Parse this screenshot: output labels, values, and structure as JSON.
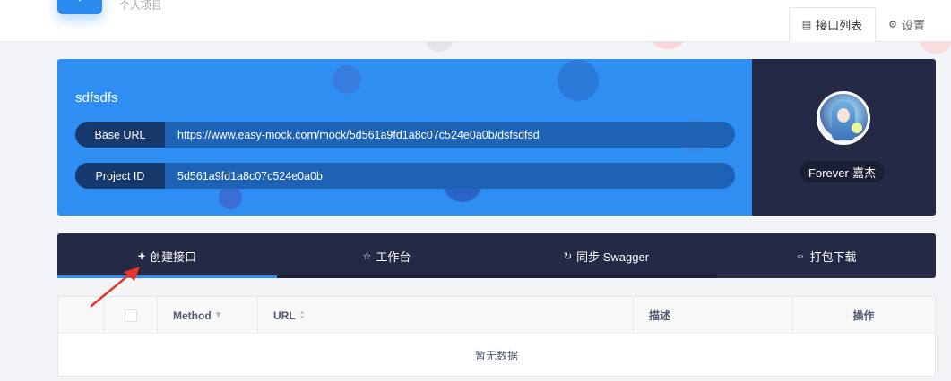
{
  "header": {
    "subtitle": "个人项目",
    "tabs": [
      {
        "icon": "list-icon",
        "label": "接口列表",
        "active": true
      },
      {
        "icon": "gear-icon",
        "label": "设置",
        "active": false
      }
    ]
  },
  "project": {
    "name": "sdfsdfs",
    "base_url_label": "Base URL",
    "base_url": "https://www.easy-mock.com/mock/5d561a9fd1a8c07c524e0a0b/dsfsdfsd",
    "project_id_label": "Project ID",
    "project_id": "5d561a9fd1a8c07c524e0a0b"
  },
  "user": {
    "name": "Forever-嘉杰"
  },
  "actions": [
    {
      "icon": "plus-icon",
      "label": "创建接口"
    },
    {
      "icon": "star-icon",
      "label": "工作台"
    },
    {
      "icon": "sync-icon",
      "label": "同步 Swagger"
    },
    {
      "icon": "download-icon",
      "label": "打包下载"
    }
  ],
  "table": {
    "columns": [
      "",
      "",
      "Method",
      "URL",
      "描述",
      "操作"
    ],
    "empty_text": "暂无数据"
  },
  "colors": {
    "primary": "#2e8ef2",
    "dark": "#242a45",
    "annotation": "#e8322a"
  }
}
